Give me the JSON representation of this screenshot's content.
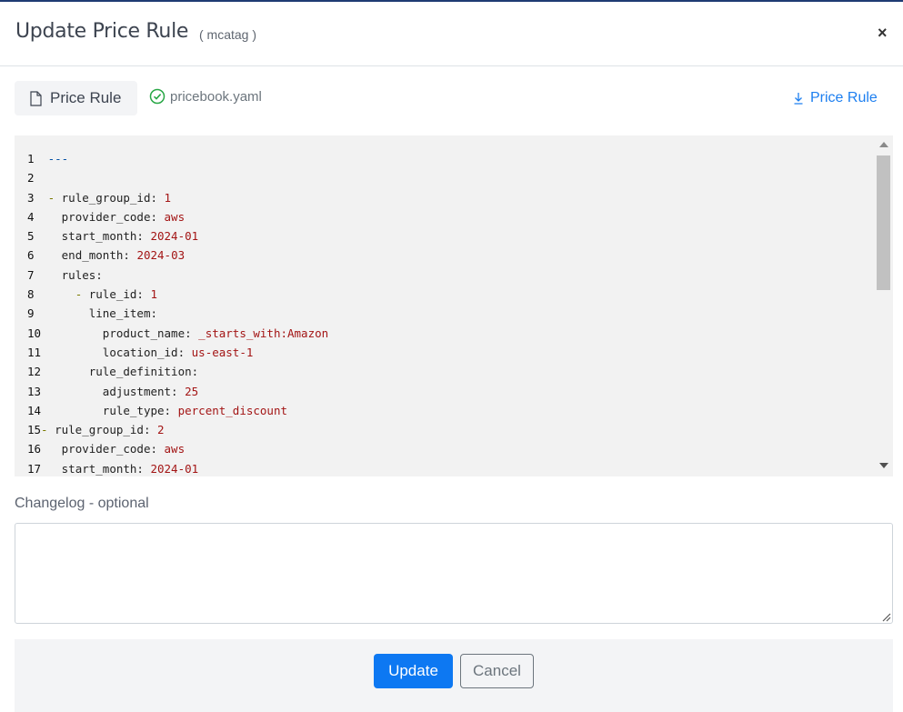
{
  "modal": {
    "title": "Update Price Rule",
    "subtitle": "( mcatag )",
    "close_label": "×"
  },
  "file_bar": {
    "tab_label": "Price Rule",
    "file_name": "pricebook.yaml",
    "download_label": "Price Rule"
  },
  "editor": {
    "language": "yaml",
    "lines": [
      {
        "num": "1",
        "indent": "",
        "dash": "",
        "key": "",
        "value": "---",
        "type": "docstart"
      },
      {
        "num": "2",
        "indent": "",
        "dash": "",
        "key": "",
        "value": "",
        "type": "blank"
      },
      {
        "num": "3",
        "indent": "",
        "dash": "- ",
        "key": "rule_group_id:",
        "value": "1"
      },
      {
        "num": "4",
        "indent": "  ",
        "dash": "",
        "key": "provider_code:",
        "value": "aws"
      },
      {
        "num": "5",
        "indent": "  ",
        "dash": "",
        "key": "start_month:",
        "value": "2024-01"
      },
      {
        "num": "6",
        "indent": "  ",
        "dash": "",
        "key": "end_month:",
        "value": "2024-03"
      },
      {
        "num": "7",
        "indent": "  ",
        "dash": "",
        "key": "rules:",
        "value": ""
      },
      {
        "num": "8",
        "indent": "    ",
        "dash": "- ",
        "key": "rule_id:",
        "value": "1"
      },
      {
        "num": "9",
        "indent": "      ",
        "dash": "",
        "key": "line_item:",
        "value": ""
      },
      {
        "num": "10",
        "indent": "        ",
        "dash": "",
        "key": "product_name:",
        "value": "_starts_with:Amazon"
      },
      {
        "num": "11",
        "indent": "        ",
        "dash": "",
        "key": "location_id:",
        "value": "us-east-1"
      },
      {
        "num": "12",
        "indent": "      ",
        "dash": "",
        "key": "rule_definition:",
        "value": ""
      },
      {
        "num": "13",
        "indent": "        ",
        "dash": "",
        "key": "adjustment:",
        "value": "25"
      },
      {
        "num": "14",
        "indent": "        ",
        "dash": "",
        "key": "rule_type:",
        "value": "percent_discount"
      },
      {
        "num": "15",
        "indent": "",
        "dash": "- ",
        "key": "rule_group_id:",
        "value": "2"
      },
      {
        "num": "16",
        "indent": "  ",
        "dash": "",
        "key": "provider_code:",
        "value": "aws"
      },
      {
        "num": "17",
        "indent": "  ",
        "dash": "",
        "key": "start_month:",
        "value": "2024-01"
      }
    ]
  },
  "changelog": {
    "label": "Changelog - optional",
    "value": "",
    "placeholder": ""
  },
  "footer": {
    "update_label": "Update",
    "cancel_label": "Cancel"
  },
  "colors": {
    "primary": "#0d78f2",
    "link": "#1d7ff0",
    "success": "#28a745",
    "yaml_value": "#a31515"
  }
}
